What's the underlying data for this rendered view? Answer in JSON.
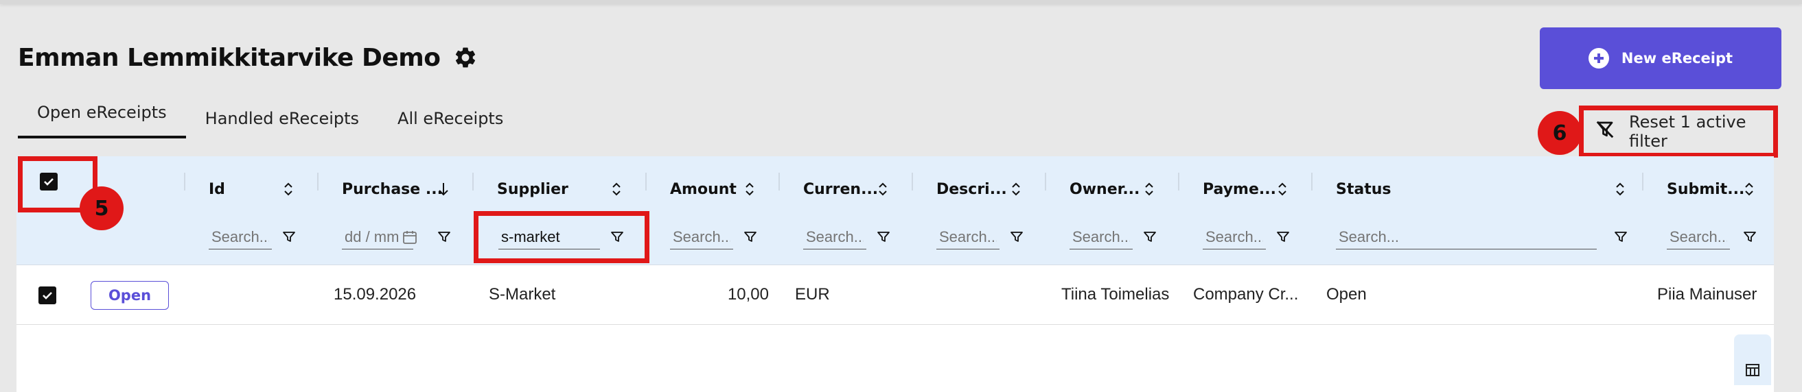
{
  "header": {
    "title": "Emman Lemmikkitarvike Demo"
  },
  "tabs": [
    {
      "label": "Open eReceipts",
      "active": true
    },
    {
      "label": "Handled eReceipts",
      "active": false
    },
    {
      "label": "All eReceipts",
      "active": false
    }
  ],
  "actions": {
    "new_receipt_label": "New eReceipt",
    "reset_filter_label": "Reset 1 active filter"
  },
  "annotations": {
    "badge_5": "5",
    "badge_6": "6"
  },
  "table": {
    "columns": {
      "id": "Id",
      "purchase": "Purchase ...",
      "supplier": "Supplier",
      "amount": "Amount",
      "currency": "Curren...",
      "description": "Descri...",
      "owner": "Owner...",
      "payment": "Payme...",
      "status": "Status",
      "submitter": "Submit..."
    },
    "filters": {
      "placeholder": "Search...",
      "status_placeholder": "Search...",
      "date_placeholder": "dd / mm",
      "supplier_value": "s-market"
    },
    "rows": [
      {
        "selected": true,
        "state_button": "Open",
        "purchase_date": "15.09.2026",
        "supplier": "S-Market",
        "amount": "10,00",
        "currency": "EUR",
        "owner": "Tiina Toimelias",
        "payment": "Company Cr...",
        "status": "Open",
        "submitter": "Piia Mainuser"
      }
    ]
  },
  "colors": {
    "accent": "#5a4fd8",
    "highlight": "#e01818",
    "header_bg": "#e3effb"
  }
}
